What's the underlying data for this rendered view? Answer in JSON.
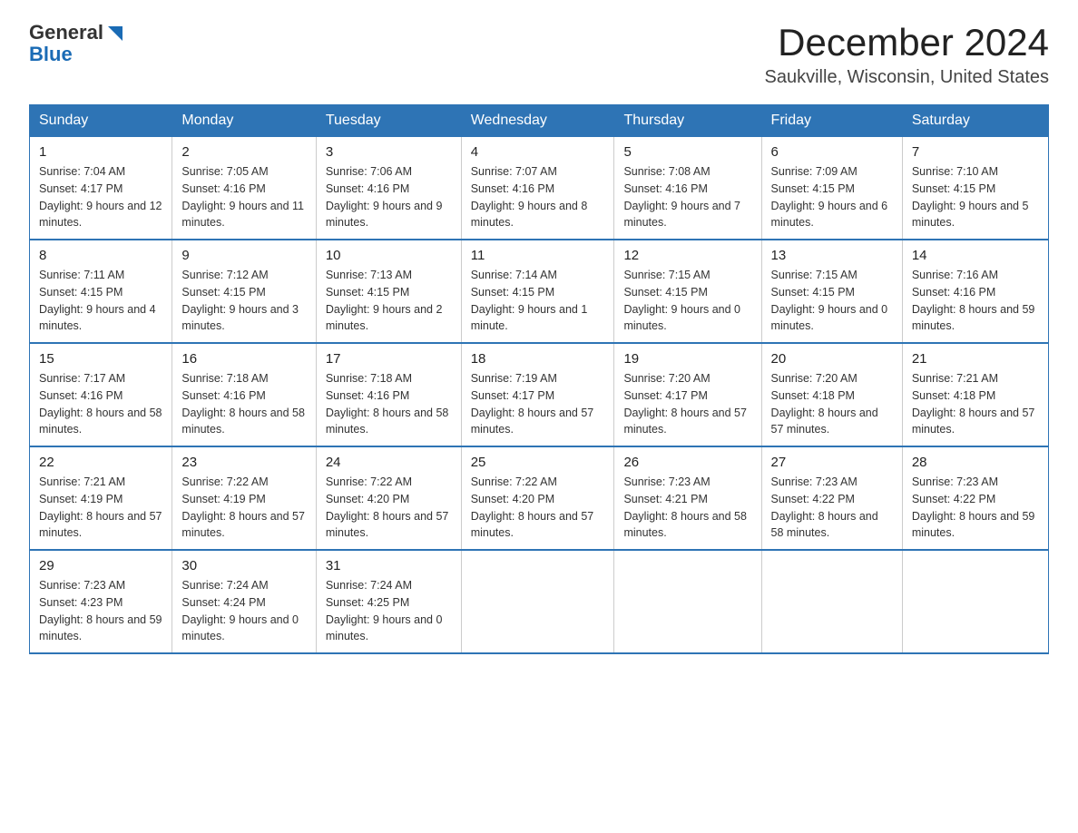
{
  "header": {
    "logo_general": "General",
    "logo_blue": "Blue",
    "title": "December 2024",
    "subtitle": "Saukville, Wisconsin, United States"
  },
  "days_of_week": [
    "Sunday",
    "Monday",
    "Tuesday",
    "Wednesday",
    "Thursday",
    "Friday",
    "Saturday"
  ],
  "weeks": [
    [
      {
        "day": "1",
        "sunrise": "Sunrise: 7:04 AM",
        "sunset": "Sunset: 4:17 PM",
        "daylight": "Daylight: 9 hours and 12 minutes."
      },
      {
        "day": "2",
        "sunrise": "Sunrise: 7:05 AM",
        "sunset": "Sunset: 4:16 PM",
        "daylight": "Daylight: 9 hours and 11 minutes."
      },
      {
        "day": "3",
        "sunrise": "Sunrise: 7:06 AM",
        "sunset": "Sunset: 4:16 PM",
        "daylight": "Daylight: 9 hours and 9 minutes."
      },
      {
        "day": "4",
        "sunrise": "Sunrise: 7:07 AM",
        "sunset": "Sunset: 4:16 PM",
        "daylight": "Daylight: 9 hours and 8 minutes."
      },
      {
        "day": "5",
        "sunrise": "Sunrise: 7:08 AM",
        "sunset": "Sunset: 4:16 PM",
        "daylight": "Daylight: 9 hours and 7 minutes."
      },
      {
        "day": "6",
        "sunrise": "Sunrise: 7:09 AM",
        "sunset": "Sunset: 4:15 PM",
        "daylight": "Daylight: 9 hours and 6 minutes."
      },
      {
        "day": "7",
        "sunrise": "Sunrise: 7:10 AM",
        "sunset": "Sunset: 4:15 PM",
        "daylight": "Daylight: 9 hours and 5 minutes."
      }
    ],
    [
      {
        "day": "8",
        "sunrise": "Sunrise: 7:11 AM",
        "sunset": "Sunset: 4:15 PM",
        "daylight": "Daylight: 9 hours and 4 minutes."
      },
      {
        "day": "9",
        "sunrise": "Sunrise: 7:12 AM",
        "sunset": "Sunset: 4:15 PM",
        "daylight": "Daylight: 9 hours and 3 minutes."
      },
      {
        "day": "10",
        "sunrise": "Sunrise: 7:13 AM",
        "sunset": "Sunset: 4:15 PM",
        "daylight": "Daylight: 9 hours and 2 minutes."
      },
      {
        "day": "11",
        "sunrise": "Sunrise: 7:14 AM",
        "sunset": "Sunset: 4:15 PM",
        "daylight": "Daylight: 9 hours and 1 minute."
      },
      {
        "day": "12",
        "sunrise": "Sunrise: 7:15 AM",
        "sunset": "Sunset: 4:15 PM",
        "daylight": "Daylight: 9 hours and 0 minutes."
      },
      {
        "day": "13",
        "sunrise": "Sunrise: 7:15 AM",
        "sunset": "Sunset: 4:15 PM",
        "daylight": "Daylight: 9 hours and 0 minutes."
      },
      {
        "day": "14",
        "sunrise": "Sunrise: 7:16 AM",
        "sunset": "Sunset: 4:16 PM",
        "daylight": "Daylight: 8 hours and 59 minutes."
      }
    ],
    [
      {
        "day": "15",
        "sunrise": "Sunrise: 7:17 AM",
        "sunset": "Sunset: 4:16 PM",
        "daylight": "Daylight: 8 hours and 58 minutes."
      },
      {
        "day": "16",
        "sunrise": "Sunrise: 7:18 AM",
        "sunset": "Sunset: 4:16 PM",
        "daylight": "Daylight: 8 hours and 58 minutes."
      },
      {
        "day": "17",
        "sunrise": "Sunrise: 7:18 AM",
        "sunset": "Sunset: 4:16 PM",
        "daylight": "Daylight: 8 hours and 58 minutes."
      },
      {
        "day": "18",
        "sunrise": "Sunrise: 7:19 AM",
        "sunset": "Sunset: 4:17 PM",
        "daylight": "Daylight: 8 hours and 57 minutes."
      },
      {
        "day": "19",
        "sunrise": "Sunrise: 7:20 AM",
        "sunset": "Sunset: 4:17 PM",
        "daylight": "Daylight: 8 hours and 57 minutes."
      },
      {
        "day": "20",
        "sunrise": "Sunrise: 7:20 AM",
        "sunset": "Sunset: 4:18 PM",
        "daylight": "Daylight: 8 hours and 57 minutes."
      },
      {
        "day": "21",
        "sunrise": "Sunrise: 7:21 AM",
        "sunset": "Sunset: 4:18 PM",
        "daylight": "Daylight: 8 hours and 57 minutes."
      }
    ],
    [
      {
        "day": "22",
        "sunrise": "Sunrise: 7:21 AM",
        "sunset": "Sunset: 4:19 PM",
        "daylight": "Daylight: 8 hours and 57 minutes."
      },
      {
        "day": "23",
        "sunrise": "Sunrise: 7:22 AM",
        "sunset": "Sunset: 4:19 PM",
        "daylight": "Daylight: 8 hours and 57 minutes."
      },
      {
        "day": "24",
        "sunrise": "Sunrise: 7:22 AM",
        "sunset": "Sunset: 4:20 PM",
        "daylight": "Daylight: 8 hours and 57 minutes."
      },
      {
        "day": "25",
        "sunrise": "Sunrise: 7:22 AM",
        "sunset": "Sunset: 4:20 PM",
        "daylight": "Daylight: 8 hours and 57 minutes."
      },
      {
        "day": "26",
        "sunrise": "Sunrise: 7:23 AM",
        "sunset": "Sunset: 4:21 PM",
        "daylight": "Daylight: 8 hours and 58 minutes."
      },
      {
        "day": "27",
        "sunrise": "Sunrise: 7:23 AM",
        "sunset": "Sunset: 4:22 PM",
        "daylight": "Daylight: 8 hours and 58 minutes."
      },
      {
        "day": "28",
        "sunrise": "Sunrise: 7:23 AM",
        "sunset": "Sunset: 4:22 PM",
        "daylight": "Daylight: 8 hours and 59 minutes."
      }
    ],
    [
      {
        "day": "29",
        "sunrise": "Sunrise: 7:23 AM",
        "sunset": "Sunset: 4:23 PM",
        "daylight": "Daylight: 8 hours and 59 minutes."
      },
      {
        "day": "30",
        "sunrise": "Sunrise: 7:24 AM",
        "sunset": "Sunset: 4:24 PM",
        "daylight": "Daylight: 9 hours and 0 minutes."
      },
      {
        "day": "31",
        "sunrise": "Sunrise: 7:24 AM",
        "sunset": "Sunset: 4:25 PM",
        "daylight": "Daylight: 9 hours and 0 minutes."
      },
      null,
      null,
      null,
      null
    ]
  ]
}
